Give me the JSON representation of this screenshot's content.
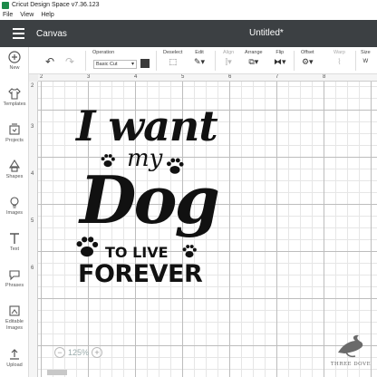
{
  "window": {
    "title": "Cricut Design Space  v7.36.123"
  },
  "menu": [
    "File",
    "View",
    "Help"
  ],
  "header": {
    "section": "Canvas",
    "document_title": "Untitled*"
  },
  "sidebar": {
    "items": [
      {
        "label": "New",
        "icon": "plus-circle-icon"
      },
      {
        "label": "Templates",
        "icon": "shirt-icon"
      },
      {
        "label": "Projects",
        "icon": "projects-icon"
      },
      {
        "label": "Shapes",
        "icon": "shapes-icon"
      },
      {
        "label": "Images",
        "icon": "lightbulb-icon"
      },
      {
        "label": "Text",
        "icon": "text-icon"
      },
      {
        "label": "Phrases",
        "icon": "speech-bubble-icon"
      },
      {
        "label": "Editable Images",
        "icon": "editable-image-icon"
      },
      {
        "label": "Upload",
        "icon": "upload-icon"
      }
    ]
  },
  "toolbar": {
    "operation_label": "Operation",
    "operation_value": "Basic Cut",
    "swatch_color": "#3a3a3a",
    "deselect_label": "Deselect",
    "edit_label": "Edit",
    "align_label": "Align",
    "arrange_label": "Arrange",
    "flip_label": "Flip",
    "offset_label": "Offset",
    "warp_label": "Warp",
    "size_label": "Size"
  },
  "ruler": {
    "top": [
      "2",
      "3",
      "4",
      "5",
      "6",
      "7",
      "8"
    ],
    "left": [
      "2",
      "3",
      "4",
      "5",
      "6"
    ]
  },
  "design": {
    "line1": "I want",
    "line2": "my",
    "line3": "Dog",
    "line4": "TO LIVE",
    "line5": "FOREVER"
  },
  "zoom": {
    "value": "125%"
  },
  "watermark": {
    "text": "THREE DOVE"
  }
}
